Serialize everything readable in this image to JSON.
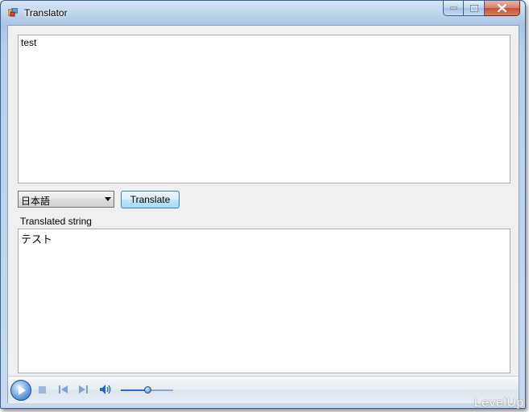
{
  "window": {
    "title": "Translator",
    "icon": "app-icon"
  },
  "caption_buttons": {
    "minimize": "minimize-icon",
    "maximize": "maximize-icon",
    "close": "close-icon"
  },
  "source": {
    "value": "test"
  },
  "language": {
    "selected": "日本語"
  },
  "translate_button": {
    "label": "Translate"
  },
  "result": {
    "label": "Translated string",
    "value": "テスト"
  },
  "player": {
    "icons": [
      "play-icon",
      "stop-icon",
      "previous-icon",
      "next-icon",
      "volume-icon"
    ],
    "volume": 0.5
  },
  "watermark": {
    "text": "LevelUp"
  },
  "colors": {
    "accent": "#2a63b8",
    "close": "#c24f36"
  }
}
